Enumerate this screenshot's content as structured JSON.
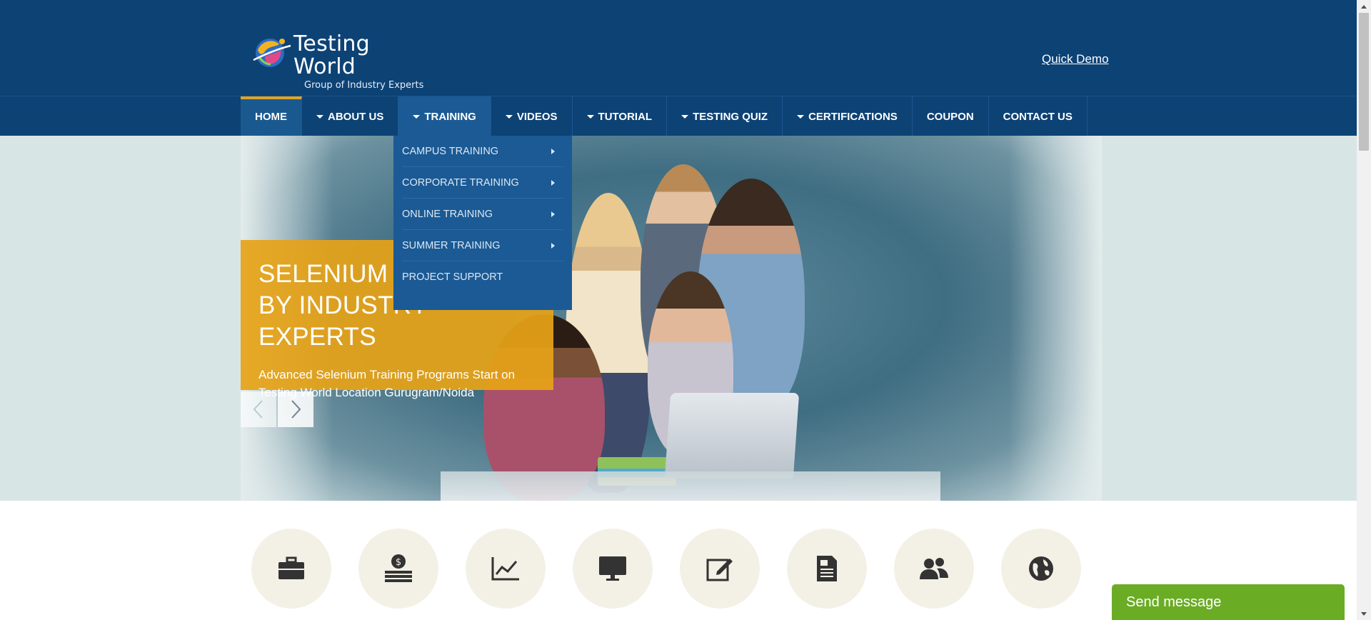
{
  "header": {
    "logo_title": "Testing World",
    "logo_subtitle": "Group of Industry Experts",
    "quick_demo": "Quick Demo"
  },
  "nav": {
    "items": [
      {
        "label": "HOME",
        "has_caret": false
      },
      {
        "label": "ABOUT US",
        "has_caret": true
      },
      {
        "label": "TRAINING",
        "has_caret": true
      },
      {
        "label": "VIDEOS",
        "has_caret": true
      },
      {
        "label": "TUTORIAL",
        "has_caret": true
      },
      {
        "label": "TESTING QUIZ",
        "has_caret": true
      },
      {
        "label": "CERTIFICATIONS",
        "has_caret": true
      },
      {
        "label": "COUPON",
        "has_caret": false
      },
      {
        "label": "CONTACT US",
        "has_caret": false
      }
    ],
    "active": "TRAINING"
  },
  "training_dropdown": {
    "items": [
      {
        "label": "CAMPUS TRAINING",
        "submenu": true
      },
      {
        "label": "CORPORATE TRAINING",
        "submenu": true
      },
      {
        "label": "ONLINE TRAINING",
        "submenu": true
      },
      {
        "label": "SUMMER TRAINING",
        "submenu": true
      },
      {
        "label": "PROJECT SUPPORT",
        "submenu": false
      }
    ]
  },
  "hero": {
    "title_line1": "SELENIUM T",
    "title_line2": "BY INDUSTRY EXPERTS",
    "text": "Advanced Selenium Training Programs Start on Testing World Location Gurugram/Noida"
  },
  "features": {
    "icons": [
      "briefcase-icon",
      "money-stack-icon",
      "line-chart-icon",
      "monitor-icon",
      "edit-icon",
      "document-icon",
      "users-icon",
      "globe-icon"
    ]
  },
  "chat": {
    "label": "Send message"
  },
  "colors": {
    "header_bg": "#0d4275",
    "nav_active": "#1b5a94",
    "accent_gold": "#e0a426",
    "caption_bg": "#e6a218",
    "chat_green": "#6bac25"
  }
}
